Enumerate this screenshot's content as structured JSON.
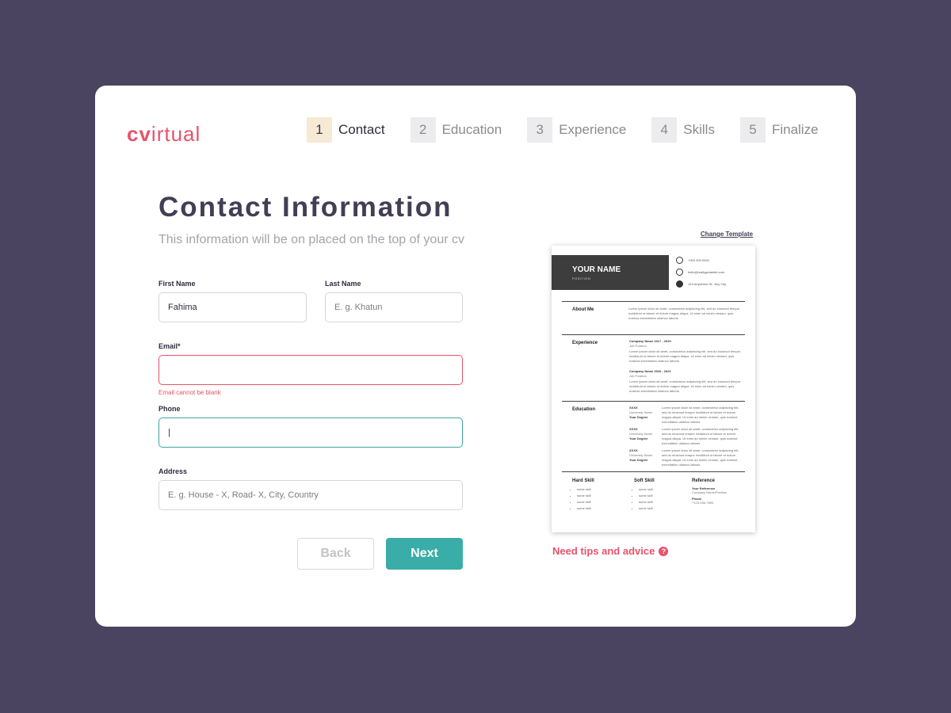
{
  "brand": {
    "prefix": "cv",
    "rest": "irtual",
    "accent": "#e8536a"
  },
  "steps": [
    {
      "num": "1",
      "label": "Contact",
      "active": true
    },
    {
      "num": "2",
      "label": "Education"
    },
    {
      "num": "3",
      "label": "Experience"
    },
    {
      "num": "4",
      "label": "Skills"
    },
    {
      "num": "5",
      "label": "Finalize"
    }
  ],
  "page": {
    "title": "Contact Information",
    "subtitle": "This information will be on placed on the top of your cv"
  },
  "form": {
    "first_name": {
      "label": "First Name",
      "value": "Fahima"
    },
    "last_name": {
      "label": "Last Name",
      "placeholder": "E. g. Khatun"
    },
    "email": {
      "label": "Email*",
      "value": "",
      "error": "Email cannot be blank"
    },
    "phone": {
      "label": "Phone",
      "value": "|"
    },
    "address": {
      "label": "Address",
      "placeholder": "E. g. House - X, Road- X, City, Country"
    }
  },
  "buttons": {
    "back": "Back",
    "next": "Next"
  },
  "preview": {
    "change_template": "Change Template",
    "name": "YOUR NAME",
    "position": "POSITION",
    "phone": "+000 000 0000",
    "email": "hello@reallygreatsite.com",
    "address": "123 Anywhere St., Any City",
    "about_title": "About Me",
    "lorem": "Lorem ipsum dolor sit amet, consectetur adipiscing elit, sed do eiusmod tempor incididunt ut labore et dolore magna aliqua. Ut enim ad minim veniam, quis nostrud exercitation ullamco laboris.",
    "experience_title": "Experience",
    "job1_company": "Company Name 2017 - 2020",
    "job1_position": "Job Position",
    "job2_company": "Company Name 2020 - 2021",
    "job2_position": "Job Position",
    "education_title": "Education",
    "edu_xxxx": "XXXX",
    "edu_university": "University Name",
    "edu_degree": "Your Degree",
    "hard_skill_title": "Hard Skill",
    "soft_skill_title": "Soft Skill",
    "reference_title": "Reference",
    "skill_item": "some skill",
    "ref_name": "Your Reference",
    "ref_company": "Company Name/Position",
    "ref_phone_label": "Phone",
    "ref_phone": "+123-456-7890"
  },
  "tips": {
    "label": "Need tips and advice",
    "icon": "question-icon"
  }
}
